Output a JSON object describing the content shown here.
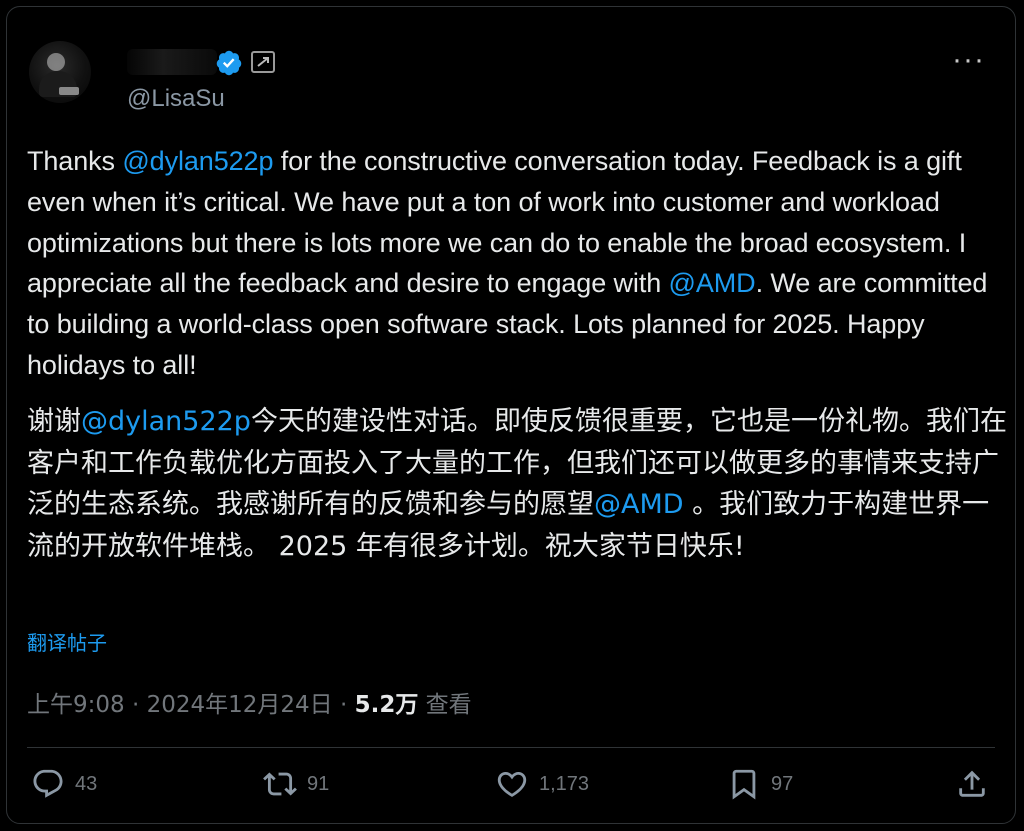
{
  "author": {
    "handle": "@LisaSu",
    "verified_color": "#1d9bf0"
  },
  "tweet": {
    "en_parts": [
      "Thanks ",
      "@dylan522p",
      " for the constructive conversation today.  Feedback is a gift even when it’s critical.  We have put a ton of work into customer and workload optimizations but there is lots more we can do to enable the broad ecosystem.  I appreciate all the feedback and desire to engage with ",
      "@AMD",
      ".  We are committed to building a world-class open software stack.  Lots planned for 2025.  Happy holidays to all!"
    ],
    "zh_parts": [
      "谢谢",
      "@dylan522p",
      "今天的建设性对话。即使反馈很重要，它也是一份礼物。我们在客户和工作负载优化方面投入了大量的工作，但我们还可以做更多的事情来支持广泛的生态系统。我感谢所有的反馈和参与的愿望",
      "@AMD",
      " 。我们致力于构建世界一流的开放软件堆栈。 2025 年有很多计划。祝大家节日快乐!"
    ],
    "translate_label": "翻译帖子"
  },
  "meta": {
    "time": "上午9:08",
    "sep1": " · ",
    "date": "2024年12月24日",
    "sep2": " · ",
    "views_count": "5.2万",
    "views_label": " 查看"
  },
  "actions": {
    "replies": "43",
    "reposts": "91",
    "likes": "1,173",
    "bookmarks": "97"
  },
  "icons": [
    "avatar",
    "verified-icon",
    "affiliation-icon",
    "more-icon",
    "reply-icon",
    "repost-icon",
    "like-icon",
    "bookmark-icon",
    "share-icon"
  ],
  "colors": {
    "background": "#000000",
    "text": "#e7e9ea",
    "link": "#1d9bf0",
    "muted": "#71767b"
  }
}
